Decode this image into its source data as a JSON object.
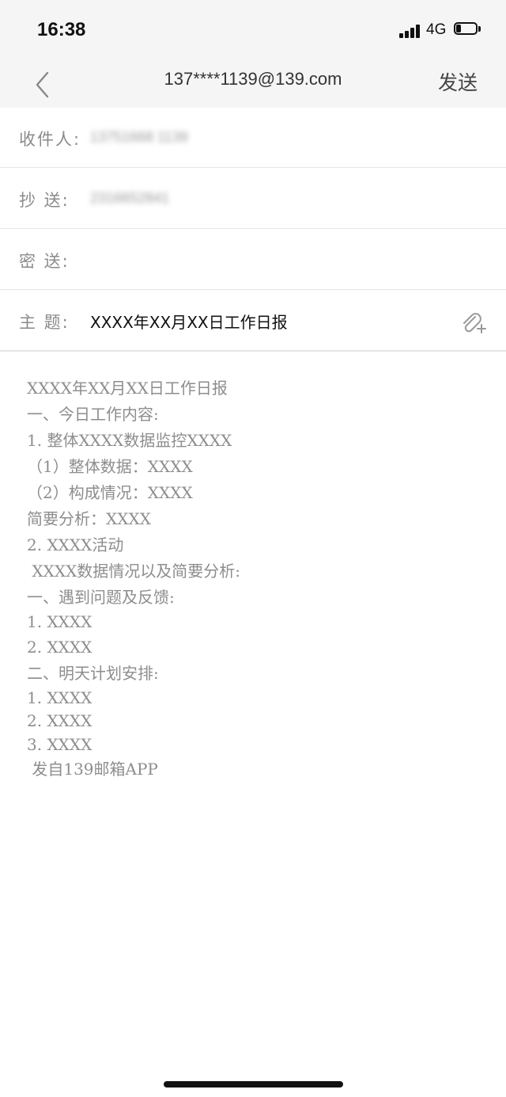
{
  "status": {
    "time": "16:38",
    "network": "4G",
    "battery_level": 0.25
  },
  "header": {
    "back_icon": "chevron-left-icon",
    "title": "137****1139@139.com",
    "send_label": "发送"
  },
  "fields": {
    "to": {
      "label": "收件人:",
      "value": "13751668 1139"
    },
    "cc": {
      "label": "抄  送:",
      "value": "2316652841"
    },
    "bcc": {
      "label": "密  送:",
      "value": ""
    },
    "subject": {
      "label": "主  题:",
      "value": "XXXX年XX月XX日工作日报",
      "attach_icon": "paperclip-add-icon"
    }
  },
  "body": {
    "lines": [
      "XXXX年XX月XX日工作日报",
      "一、今日工作内容:",
      "1. 整体XXXX数据监控XXXX",
      "（1）整体数据：XXXX",
      "（2）构成情况：XXXX",
      "简要分析：XXXX",
      "2. XXXX活动",
      " XXXX数据情况以及简要分析:",
      "一、遇到问题及反馈:",
      "1. XXXX",
      "2. XXXX",
      "二、明天计划安排:",
      "1. XXXX",
      "2. XXXX",
      "3. XXXX",
      " 发自139邮箱APP"
    ]
  }
}
